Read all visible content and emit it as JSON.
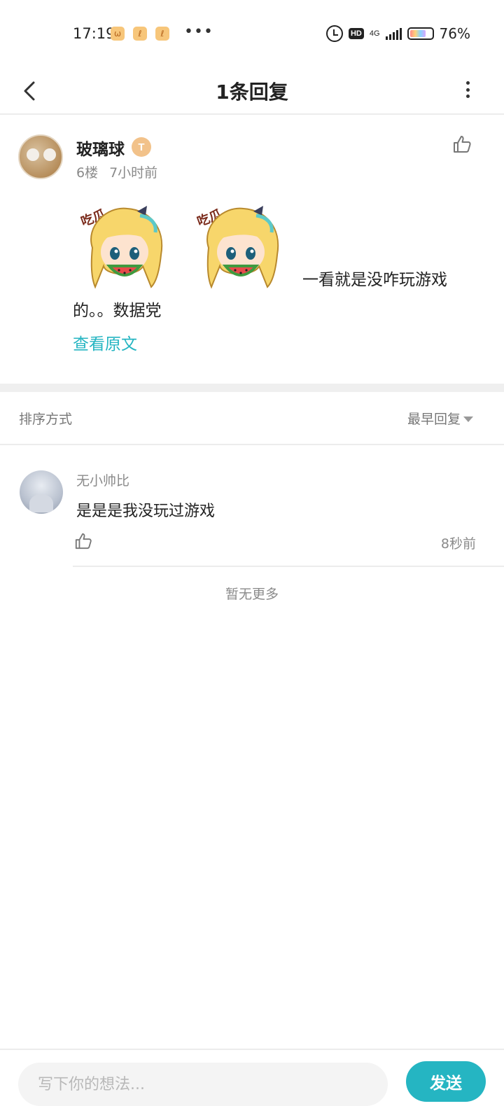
{
  "status_bar": {
    "time": "17:19",
    "network": "4G",
    "hd": "HD",
    "battery": "76%",
    "more": "•••"
  },
  "header": {
    "title": "1条回复"
  },
  "main_comment": {
    "user_name": "玻璃球",
    "level_badge": "T",
    "floor": "6楼",
    "time": "7小时前",
    "text_tail": "一看就是没咋玩游戏",
    "text_line2": "的。。数据党",
    "view_original": "查看原文",
    "sticker_icon": "girl-eating-watermelon-sticker"
  },
  "sort": {
    "label": "排序方式",
    "value": "最早回复"
  },
  "reply": {
    "user_name": "无小帅比",
    "text": "是是是我没玩过游戏",
    "time": "8秒前"
  },
  "no_more": "暂无更多",
  "input": {
    "placeholder": "写下你的想法...",
    "value": ""
  },
  "send_label": "发送",
  "colors": {
    "accent": "#25b5c2",
    "divider": "#ececec",
    "muted_text": "#8a8a8a"
  }
}
